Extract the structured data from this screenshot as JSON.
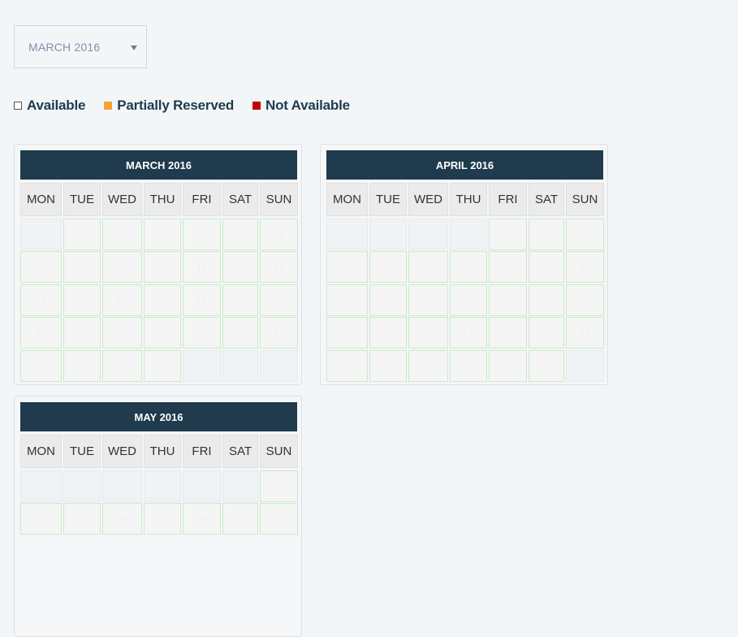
{
  "month_select": {
    "value": "MARCH 2016",
    "icon": "chevron-down-icon"
  },
  "legend": [
    {
      "label": "Available",
      "color": "#ffffff",
      "border": "#555555"
    },
    {
      "label": "Partially Reserved",
      "color": "#f7a234"
    },
    {
      "label": "Not Available",
      "color": "#c00000"
    }
  ],
  "colors": {
    "header": "#1f3b4d",
    "available_border": "#c8ecc6",
    "background": "#f3f6f9"
  },
  "weekdays": [
    "MON",
    "TUE",
    "WED",
    "THU",
    "FRI",
    "SAT",
    "SUN"
  ],
  "calendars": [
    {
      "title": "MARCH 2016",
      "lead": 1,
      "days": [
        "01",
        "02",
        "03",
        "04",
        "05",
        "06",
        "07",
        "08",
        "09",
        "10",
        "11",
        "12",
        "13",
        "14",
        "15",
        "16",
        "17",
        "18",
        "19",
        "20",
        "21",
        "22",
        "23",
        "24",
        "25",
        "26",
        "27",
        "28",
        "29",
        "30",
        "31"
      ]
    },
    {
      "title": "APRIL 2016",
      "lead": 4,
      "days": [
        "01",
        "02",
        "03",
        "04",
        "05",
        "06",
        "07",
        "08",
        "09",
        "10",
        "11",
        "12",
        "13",
        "14",
        "15",
        "16",
        "17",
        "18",
        "19",
        "20",
        "21",
        "22",
        "23",
        "24",
        "25",
        "26",
        "27",
        "28",
        "29",
        "30"
      ]
    },
    {
      "title": "MAY 2016",
      "lead": 6,
      "days": [
        "01",
        "02",
        "03",
        "04",
        "05",
        "06",
        "07",
        "08"
      ]
    }
  ]
}
